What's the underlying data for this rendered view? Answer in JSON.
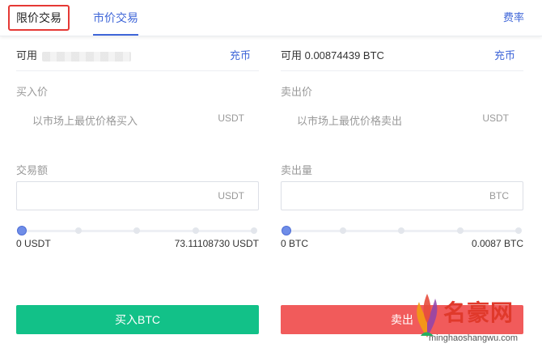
{
  "tabs": [
    {
      "label": "限价交易"
    },
    {
      "label": "市价交易"
    }
  ],
  "fee_label": "费率",
  "buy": {
    "available_label": "可用",
    "available_value": "",
    "recharge": "充币",
    "price_label": "买入价",
    "price_hint": "以市场上最优价格买入",
    "price_unit": "USDT",
    "amount_label": "交易额",
    "amount_unit": "USDT",
    "amount_value": "",
    "slider_level": 0,
    "range_min": "0 USDT",
    "range_max": "73.11108730 USDT",
    "button": "买入BTC"
  },
  "sell": {
    "available_text": "可用 0.00874439 BTC",
    "recharge": "充币",
    "price_label": "卖出价",
    "price_hint": "以市场上最优价格卖出",
    "price_unit": "USDT",
    "amount_label": "卖出量",
    "amount_unit": "BTC",
    "amount_value": "",
    "slider_level": 0,
    "range_min": "0 BTC",
    "range_max": "0.0087 BTC",
    "button": "卖出"
  },
  "watermark": {
    "text": "名豪网",
    "url": "minghaoshangwu.com"
  },
  "colors": {
    "accent_blue": "#3f66d8",
    "buy_green": "#12c188",
    "sell_red": "#f15b5b",
    "tab_highlight": "#e53935"
  }
}
